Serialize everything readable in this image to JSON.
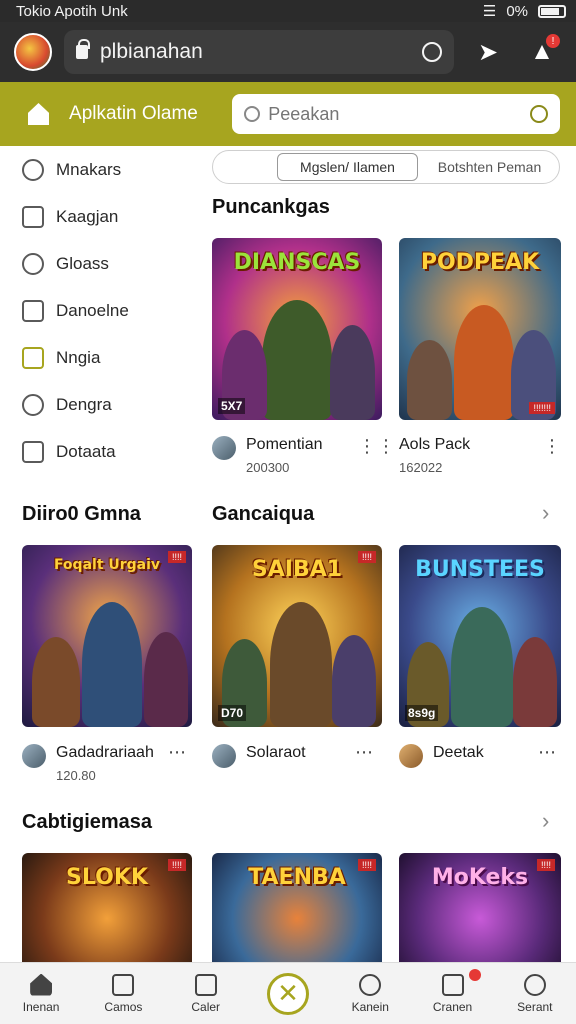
{
  "status_bar": {
    "left_text": "Tokio Apotih Unk",
    "battery": "0%"
  },
  "topbar": {
    "url": "plbianahan",
    "notification_count": "!"
  },
  "header": {
    "title": "Aplkatin Olame",
    "search_placeholder": "Peeakan"
  },
  "sidebar": {
    "items": [
      {
        "label": "Mnakars",
        "icon": "user-icon"
      },
      {
        "label": "Kaagjan",
        "icon": "calendar-icon"
      },
      {
        "label": "Gloass",
        "icon": "smile-icon"
      },
      {
        "label": "Danoelne",
        "icon": "document-icon"
      },
      {
        "label": "Nngia",
        "icon": "home-icon"
      },
      {
        "label": "Dengra",
        "icon": "pin-icon"
      },
      {
        "label": "Dotaata",
        "icon": "tag-icon"
      }
    ]
  },
  "segment": {
    "options": [
      "",
      "Mgslen/ Ilamen",
      "Botshten Peman"
    ],
    "active_index": 1
  },
  "sections": {
    "top": {
      "title": "Puncankgas",
      "cards": [
        {
          "art_title": "DIANSCAS",
          "tag": "5X7",
          "name": "Pomentian",
          "sub": "200300"
        },
        {
          "art_title": "PODPEAK",
          "badge": "!!!!!!!",
          "name": "Aols Pack",
          "sub": "162022"
        }
      ]
    },
    "middle": {
      "title_left": "Diiro0 Gmna",
      "title_right": "Gancaiqua",
      "cards": [
        {
          "art_title": "Foqalt Urgaiv",
          "badge": "!!!!",
          "name": "Gadadrariaah",
          "sub": "120.80"
        },
        {
          "art_title": "SAIBA1",
          "tag": "D70",
          "badge": "!!!!",
          "name": "Solaraot",
          "sub": ""
        },
        {
          "art_title": "BUNSTEES",
          "tag": "8s9g",
          "name": "Deetak",
          "sub": ""
        }
      ]
    },
    "bottom": {
      "title": "Cabtigiemasa",
      "cards": [
        {
          "art_title": "SLOKK",
          "badge": "!!!!"
        },
        {
          "art_title": "TAENBA",
          "badge": "!!!!"
        },
        {
          "art_title": "MoKeks",
          "badge": "!!!!"
        }
      ]
    }
  },
  "bottom_nav": [
    {
      "label": "Inenan",
      "icon": "home-icon"
    },
    {
      "label": "Camos",
      "icon": "grid-icon"
    },
    {
      "label": "Caler",
      "icon": "edit-icon"
    },
    {
      "label": "",
      "icon": "close-circle-icon"
    },
    {
      "label": "Kanein",
      "icon": "search-icon"
    },
    {
      "label": "Cranen",
      "icon": "inbox-icon"
    },
    {
      "label": "Serant",
      "icon": "profile-icon"
    }
  ]
}
